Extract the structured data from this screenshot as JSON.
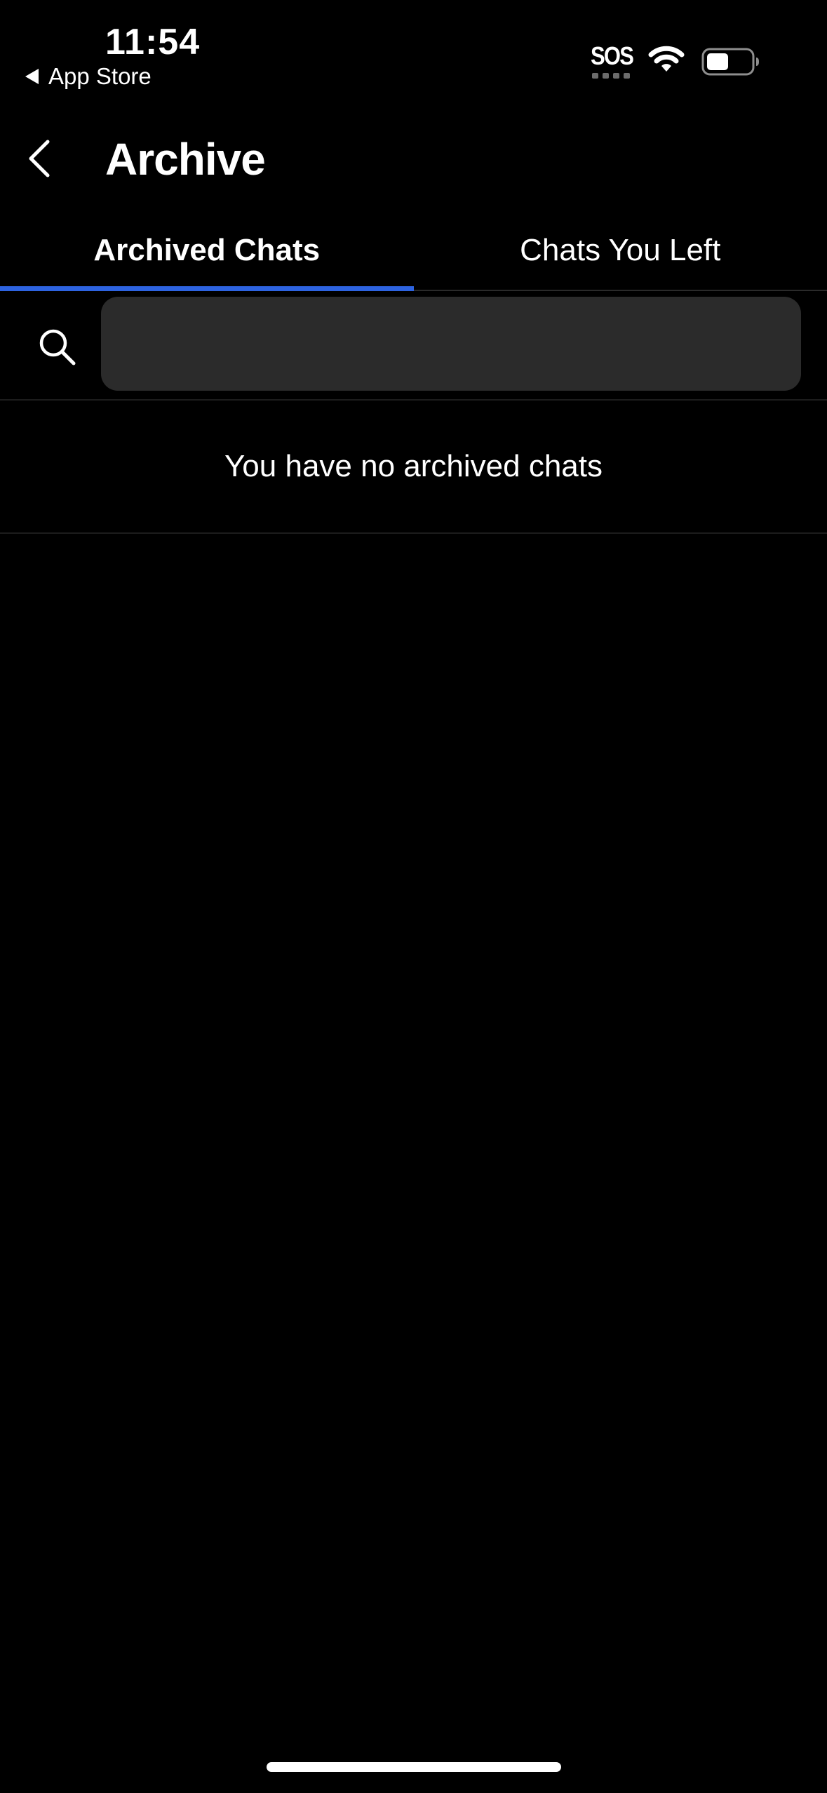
{
  "status_bar": {
    "time": "11:54",
    "back_to_app": "App Store",
    "sos": "SOS",
    "wifi_icon": "wifi-icon",
    "battery_icon": "battery-icon"
  },
  "header": {
    "title": "Archive",
    "back_icon": "chevron-left-icon"
  },
  "tabs": [
    {
      "label": "Archived Chats",
      "active": true
    },
    {
      "label": "Chats You Left",
      "active": false
    }
  ],
  "search": {
    "value": "",
    "placeholder": "",
    "icon": "search-icon"
  },
  "empty_state": {
    "message": "You have no archived chats"
  },
  "colors": {
    "background": "#000000",
    "accent": "#2d63e0",
    "search_field": "#2b2b2b",
    "text": "#ffffff"
  }
}
